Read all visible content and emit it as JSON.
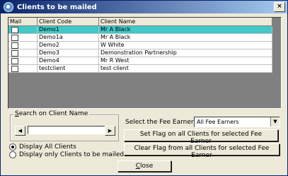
{
  "window": {
    "title": "Clients to be mailed",
    "close_glyph": "×"
  },
  "grid": {
    "headers": {
      "mail": "Mail",
      "code": "Client Code",
      "name": "Client Name"
    },
    "rows": [
      {
        "code": "Demo1",
        "name": "Mr A Black",
        "checked": false,
        "selected": true
      },
      {
        "code": "Demo1a",
        "name": "Mr A Black",
        "checked": false,
        "selected": false
      },
      {
        "code": "Demo2",
        "name": "W White",
        "checked": false,
        "selected": false
      },
      {
        "code": "Demo3",
        "name": "Demonstration Partnership",
        "checked": false,
        "selected": false
      },
      {
        "code": "Demo4",
        "name": "Mr R West",
        "checked": false,
        "selected": false
      },
      {
        "code": "testclient",
        "name": "test client",
        "checked": false,
        "selected": false
      }
    ],
    "selected_row_color": "#41c8c8"
  },
  "search": {
    "label_accel": "S",
    "label_rest": "earch on Client Name",
    "value": "",
    "prev_glyph": "◀",
    "next_glyph": "▶"
  },
  "display": {
    "all_label": "Display All Clients",
    "only_label": "Display only Clients to be mailed",
    "selected": "all"
  },
  "fee": {
    "label": "Select the Fee Earner",
    "selected": "All Fee Earners",
    "dropdown_glyph": "▼"
  },
  "buttons": {
    "set_flag": "Set Flag on all Clients for selected Fee Earner",
    "clear_flag": "Clear Flag from all Clients for selected Fee Earner",
    "close_accel": "C",
    "close_rest": "lose"
  }
}
